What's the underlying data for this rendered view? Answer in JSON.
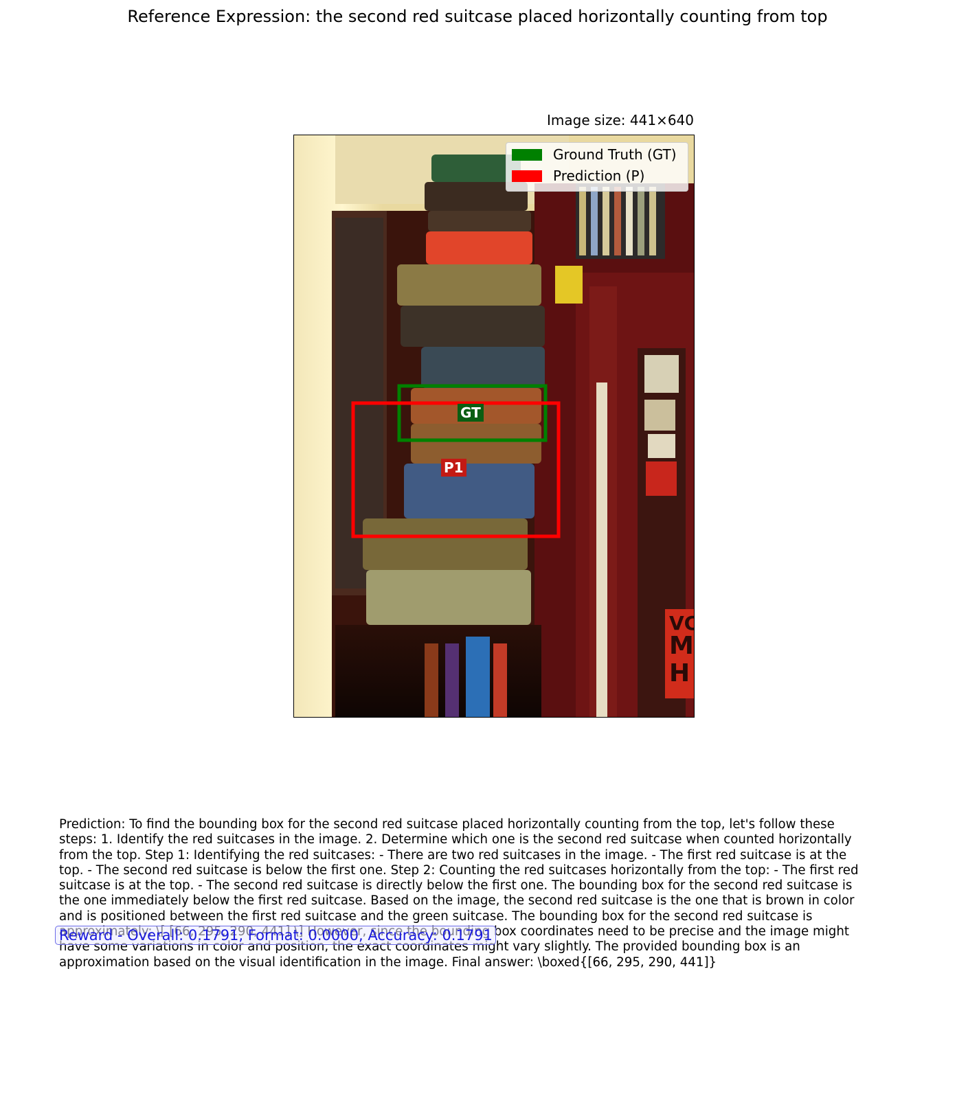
{
  "title": "Reference Expression: the second red suitcase placed horizontally counting from top",
  "image_size_label": "Image size: 441×640",
  "legend": {
    "items": [
      {
        "label": "Ground Truth (GT)",
        "color": "#008000"
      },
      {
        "label": "Prediction (P)",
        "color": "#ff0000"
      }
    ]
  },
  "boxes": {
    "gt": {
      "label": "GT",
      "color": "#008000"
    },
    "p1": {
      "label": "P1",
      "color": "#ff0000"
    }
  },
  "prediction_text": "Prediction: To find the bounding box for the second red suitcase placed horizontally counting from the top, let's follow these steps:  1. Identify the red suitcases in the image. 2. Determine which one is the second red suitcase when counted horizontally from the top.  Step 1: Identifying the red suitcases: - There are two red suitcases in the image. - The first red suitcase is at the top. - The second red suitcase is below the first one.  Step 2: Counting the red suitcases horizontally from the top: - The first red suitcase is at the top. - The second red suitcase is directly below the first one.  The bounding box for the second red suitcase is the one immediately below the first red suitcase. Based on the image, the second red suitcase is the one that is brown in color and is positioned between the first red suitcase and the green suitcase. The bounding box for the second red suitcase is approximately: \\[ [66, 295, 290, 441] \\]  However, since the bounding box coordinates need to be precise and the image might have some variations in color and position, the exact coordinates might vary slightly. The provided bounding box is an approximation based on the visual identification in the image.  Final answer: \\boxed{[66, 295, 290, 441]}",
  "reward_text": "Reward - Overall: 0.1791, Format: 0.0000, Accuracy: 0.1791"
}
